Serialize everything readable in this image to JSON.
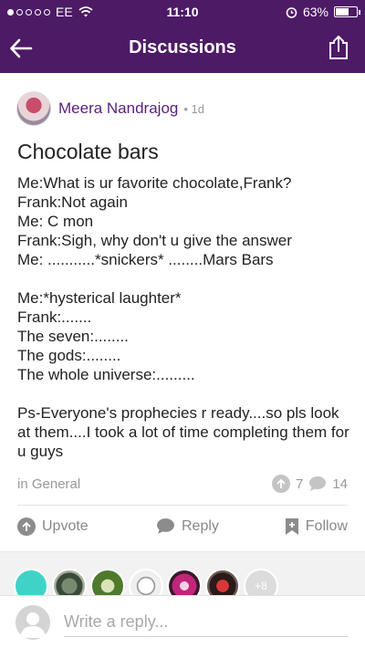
{
  "status": {
    "carrier": "EE",
    "time": "11:10",
    "battery": "63%",
    "battery_fraction": 0.63,
    "signal_bars_filled": 1,
    "signal_bars_total": 5
  },
  "header": {
    "title": "Discussions"
  },
  "post": {
    "author": "Meera Nandrajog",
    "time_ago": "1d",
    "title": "Chocolate bars",
    "body_lines": [
      "Me:What is ur favorite chocolate,Frank?",
      "Frank:Not again",
      "Me: C mon",
      "Frank:Sigh, why don't u give the answer",
      "Me: ...........*snickers* ........Mars Bars",
      "",
      "Me:*hysterical laughter*",
      "Frank:.......",
      "The seven:........",
      "The gods:........",
      "The whole universe:.........",
      "",
      "Ps-Everyone's prophecies r ready....so pls look at them....I took a lot of time completing them for u guys"
    ],
    "category": "in General",
    "upvotes": "7",
    "replies": "14"
  },
  "actions": {
    "upvote": "Upvote",
    "reply": "Reply",
    "follow": "Follow"
  },
  "participants": {
    "more": "+8"
  },
  "reply_box": {
    "placeholder": "Write a reply..."
  },
  "colors": {
    "header_bg": "#4d1a66",
    "author": "#5a1f7a"
  }
}
